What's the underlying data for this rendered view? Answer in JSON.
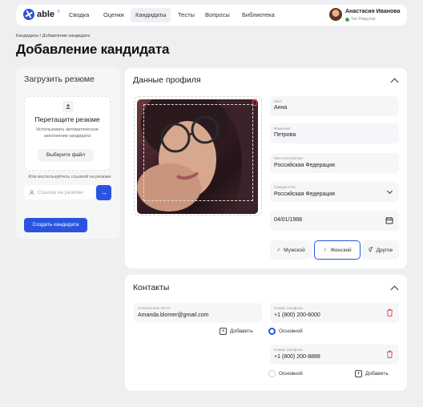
{
  "nav": {
    "logo": "able",
    "logo_sup": "®",
    "items": [
      "Сводка",
      "Оценки",
      "Кандидаты",
      "Тесты",
      "Вопросы",
      "Библиотека"
    ],
    "user_name": "Анастасия Иванова",
    "user_role": "Тех Рекрутер"
  },
  "breadcrumb": "Кандидаты / Добавление кандидата",
  "page_title": "Добавление кандидата",
  "upload": {
    "title": "Загрузить резюме",
    "drop_title": "Перетащите резюме",
    "drop_sub": "Использовать автоматическое заполнение кандидата",
    "choose_file": "Выберите файл",
    "or_link": "Или воспользуйтесь ссылкой на резюме",
    "link_placeholder": "Ссылка на резюме",
    "go_icon": "→",
    "create_button": "Создать кандидата"
  },
  "profile": {
    "title": "Данные профиля",
    "first_name_label": "Имя*",
    "first_name": "Анна",
    "last_name_label": "Фамилия*",
    "last_name": "Петрова",
    "location_label": "Местоположение",
    "location": "Российская Федерация",
    "citizenship_label": "Гражданство",
    "citizenship": "Российская Федерация",
    "birthdate": "04/01/1988",
    "gender_options": [
      "Мужской",
      "Женский",
      "Другое"
    ],
    "gender_selected": "Женский"
  },
  "contacts": {
    "title": "Контакты",
    "email_label": "Электронная почта",
    "email": "Amanda.blomer@gmail.com",
    "phone_label": "Номер телефона",
    "phone1": "+1 (800) 200-6000",
    "phone2": "+1 (800) 200-8888",
    "add_label": "Добавить",
    "primary_label": "Основной"
  },
  "colors": {
    "accent": "#2a54e0",
    "danger": "#e0524f",
    "background": "#eeeff1"
  }
}
